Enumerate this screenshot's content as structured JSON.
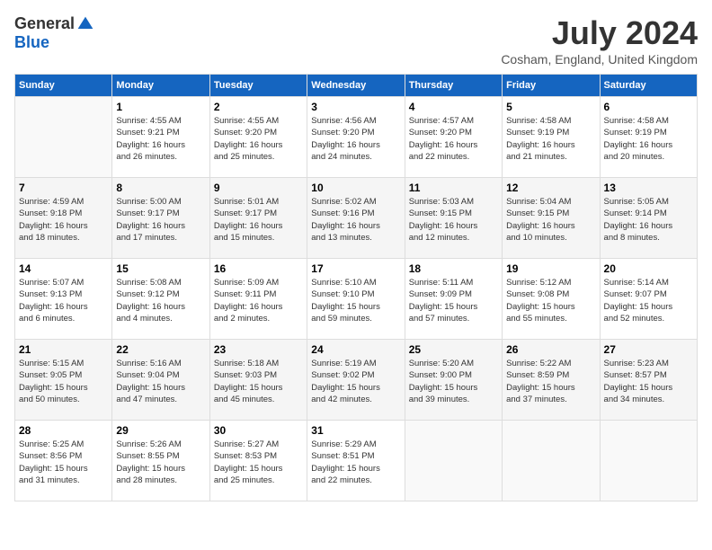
{
  "logo": {
    "general": "General",
    "blue": "Blue"
  },
  "title": "July 2024",
  "location": "Cosham, England, United Kingdom",
  "days_of_week": [
    "Sunday",
    "Monday",
    "Tuesday",
    "Wednesday",
    "Thursday",
    "Friday",
    "Saturday"
  ],
  "weeks": [
    [
      {
        "day": "",
        "info": ""
      },
      {
        "day": "1",
        "info": "Sunrise: 4:55 AM\nSunset: 9:21 PM\nDaylight: 16 hours\nand 26 minutes."
      },
      {
        "day": "2",
        "info": "Sunrise: 4:55 AM\nSunset: 9:20 PM\nDaylight: 16 hours\nand 25 minutes."
      },
      {
        "day": "3",
        "info": "Sunrise: 4:56 AM\nSunset: 9:20 PM\nDaylight: 16 hours\nand 24 minutes."
      },
      {
        "day": "4",
        "info": "Sunrise: 4:57 AM\nSunset: 9:20 PM\nDaylight: 16 hours\nand 22 minutes."
      },
      {
        "day": "5",
        "info": "Sunrise: 4:58 AM\nSunset: 9:19 PM\nDaylight: 16 hours\nand 21 minutes."
      },
      {
        "day": "6",
        "info": "Sunrise: 4:58 AM\nSunset: 9:19 PM\nDaylight: 16 hours\nand 20 minutes."
      }
    ],
    [
      {
        "day": "7",
        "info": "Sunrise: 4:59 AM\nSunset: 9:18 PM\nDaylight: 16 hours\nand 18 minutes."
      },
      {
        "day": "8",
        "info": "Sunrise: 5:00 AM\nSunset: 9:17 PM\nDaylight: 16 hours\nand 17 minutes."
      },
      {
        "day": "9",
        "info": "Sunrise: 5:01 AM\nSunset: 9:17 PM\nDaylight: 16 hours\nand 15 minutes."
      },
      {
        "day": "10",
        "info": "Sunrise: 5:02 AM\nSunset: 9:16 PM\nDaylight: 16 hours\nand 13 minutes."
      },
      {
        "day": "11",
        "info": "Sunrise: 5:03 AM\nSunset: 9:15 PM\nDaylight: 16 hours\nand 12 minutes."
      },
      {
        "day": "12",
        "info": "Sunrise: 5:04 AM\nSunset: 9:15 PM\nDaylight: 16 hours\nand 10 minutes."
      },
      {
        "day": "13",
        "info": "Sunrise: 5:05 AM\nSunset: 9:14 PM\nDaylight: 16 hours\nand 8 minutes."
      }
    ],
    [
      {
        "day": "14",
        "info": "Sunrise: 5:07 AM\nSunset: 9:13 PM\nDaylight: 16 hours\nand 6 minutes."
      },
      {
        "day": "15",
        "info": "Sunrise: 5:08 AM\nSunset: 9:12 PM\nDaylight: 16 hours\nand 4 minutes."
      },
      {
        "day": "16",
        "info": "Sunrise: 5:09 AM\nSunset: 9:11 PM\nDaylight: 16 hours\nand 2 minutes."
      },
      {
        "day": "17",
        "info": "Sunrise: 5:10 AM\nSunset: 9:10 PM\nDaylight: 15 hours\nand 59 minutes."
      },
      {
        "day": "18",
        "info": "Sunrise: 5:11 AM\nSunset: 9:09 PM\nDaylight: 15 hours\nand 57 minutes."
      },
      {
        "day": "19",
        "info": "Sunrise: 5:12 AM\nSunset: 9:08 PM\nDaylight: 15 hours\nand 55 minutes."
      },
      {
        "day": "20",
        "info": "Sunrise: 5:14 AM\nSunset: 9:07 PM\nDaylight: 15 hours\nand 52 minutes."
      }
    ],
    [
      {
        "day": "21",
        "info": "Sunrise: 5:15 AM\nSunset: 9:05 PM\nDaylight: 15 hours\nand 50 minutes."
      },
      {
        "day": "22",
        "info": "Sunrise: 5:16 AM\nSunset: 9:04 PM\nDaylight: 15 hours\nand 47 minutes."
      },
      {
        "day": "23",
        "info": "Sunrise: 5:18 AM\nSunset: 9:03 PM\nDaylight: 15 hours\nand 45 minutes."
      },
      {
        "day": "24",
        "info": "Sunrise: 5:19 AM\nSunset: 9:02 PM\nDaylight: 15 hours\nand 42 minutes."
      },
      {
        "day": "25",
        "info": "Sunrise: 5:20 AM\nSunset: 9:00 PM\nDaylight: 15 hours\nand 39 minutes."
      },
      {
        "day": "26",
        "info": "Sunrise: 5:22 AM\nSunset: 8:59 PM\nDaylight: 15 hours\nand 37 minutes."
      },
      {
        "day": "27",
        "info": "Sunrise: 5:23 AM\nSunset: 8:57 PM\nDaylight: 15 hours\nand 34 minutes."
      }
    ],
    [
      {
        "day": "28",
        "info": "Sunrise: 5:25 AM\nSunset: 8:56 PM\nDaylight: 15 hours\nand 31 minutes."
      },
      {
        "day": "29",
        "info": "Sunrise: 5:26 AM\nSunset: 8:55 PM\nDaylight: 15 hours\nand 28 minutes."
      },
      {
        "day": "30",
        "info": "Sunrise: 5:27 AM\nSunset: 8:53 PM\nDaylight: 15 hours\nand 25 minutes."
      },
      {
        "day": "31",
        "info": "Sunrise: 5:29 AM\nSunset: 8:51 PM\nDaylight: 15 hours\nand 22 minutes."
      },
      {
        "day": "",
        "info": ""
      },
      {
        "day": "",
        "info": ""
      },
      {
        "day": "",
        "info": ""
      }
    ]
  ]
}
